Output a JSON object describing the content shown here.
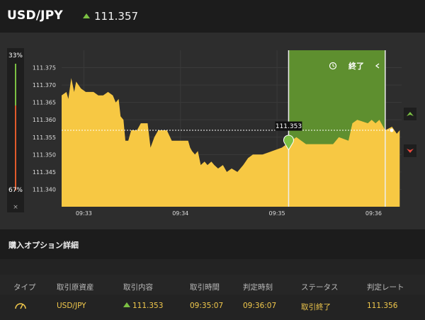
{
  "header": {
    "pair": "USD/JPY",
    "price": "111.357",
    "trend_icon": "up-arrow-icon"
  },
  "gauge": {
    "top_pct": "33%",
    "bottom_pct": "67%",
    "close": "×",
    "top_share": 0.33,
    "bottom_share": 0.67,
    "up_color": "#7bc043",
    "down_color": "#e05a2b"
  },
  "chart": {
    "end_label": "終了",
    "entry_price_label": "111.353",
    "colors": {
      "area": "#f7c843",
      "window": "#5e8f2f",
      "up": "#7bc043",
      "down": "#e8493e"
    }
  },
  "chart_data": {
    "type": "area",
    "ylim": [
      111.335,
      111.38
    ],
    "yticks": [
      "111.375",
      "111.370",
      "111.365",
      "111.360",
      "111.355",
      "111.350",
      "111.345",
      "111.340"
    ],
    "xticks": [
      "09:33",
      "09:34",
      "09:35",
      "09:36"
    ],
    "xlim_min": [
      32.77,
      36.29
    ],
    "entry": {
      "time": "09:35:07",
      "value": 111.353
    },
    "window": {
      "start_min": 35.12,
      "end_min": 36.12
    },
    "current_value": 111.357,
    "series": [
      {
        "points": [
          [
            32.77,
            111.367
          ],
          [
            32.82,
            111.368
          ],
          [
            32.84,
            111.366
          ],
          [
            32.87,
            111.372
          ],
          [
            32.9,
            111.368
          ],
          [
            32.92,
            111.371
          ],
          [
            32.97,
            111.369
          ],
          [
            33.02,
            111.368
          ],
          [
            33.1,
            111.368
          ],
          [
            33.15,
            111.367
          ],
          [
            33.2,
            111.367
          ],
          [
            33.25,
            111.368
          ],
          [
            33.3,
            111.367
          ],
          [
            33.33,
            111.365
          ],
          [
            33.36,
            111.366
          ],
          [
            33.38,
            111.361
          ],
          [
            33.41,
            111.36
          ],
          [
            33.43,
            111.354
          ],
          [
            33.46,
            111.354
          ],
          [
            33.49,
            111.357
          ],
          [
            33.55,
            111.357
          ],
          [
            33.59,
            111.359
          ],
          [
            33.66,
            111.359
          ],
          [
            33.69,
            111.352
          ],
          [
            33.73,
            111.355
          ],
          [
            33.77,
            111.357
          ],
          [
            33.86,
            111.357
          ],
          [
            33.91,
            111.354
          ],
          [
            34.0,
            111.354
          ],
          [
            34.08,
            111.354
          ],
          [
            34.1,
            111.352
          ],
          [
            34.12,
            111.351
          ],
          [
            34.15,
            111.35
          ],
          [
            34.18,
            111.351
          ],
          [
            34.21,
            111.347
          ],
          [
            34.25,
            111.348
          ],
          [
            34.28,
            111.347
          ],
          [
            34.32,
            111.348
          ],
          [
            34.35,
            111.347
          ],
          [
            34.39,
            111.346
          ],
          [
            34.44,
            111.347
          ],
          [
            34.48,
            111.345
          ],
          [
            34.53,
            111.346
          ],
          [
            34.59,
            111.345
          ],
          [
            34.65,
            111.347
          ],
          [
            34.7,
            111.349
          ],
          [
            34.75,
            111.35
          ],
          [
            34.85,
            111.35
          ],
          [
            34.95,
            111.351
          ],
          [
            35.05,
            111.352
          ],
          [
            35.1,
            111.353
          ],
          [
            35.15,
            111.354
          ],
          [
            35.2,
            111.355
          ],
          [
            35.3,
            111.353
          ],
          [
            35.45,
            111.353
          ],
          [
            35.58,
            111.353
          ],
          [
            35.64,
            111.355
          ],
          [
            35.74,
            111.354
          ],
          [
            35.78,
            111.359
          ],
          [
            35.83,
            111.36
          ],
          [
            35.94,
            111.359
          ],
          [
            35.98,
            111.36
          ],
          [
            36.02,
            111.359
          ],
          [
            36.06,
            111.36
          ],
          [
            36.12,
            111.357
          ],
          [
            36.19,
            111.358
          ],
          [
            36.24,
            111.356
          ],
          [
            36.27,
            111.357
          ]
        ]
      }
    ]
  },
  "details": {
    "title": "購入オプション詳細",
    "headers": [
      "タイプ",
      "取引原資産",
      "取引内容",
      "取引時間",
      "判定時刻",
      "ステータス",
      "判定レート"
    ],
    "row": {
      "type_icon": "gauge-icon",
      "asset": "USD/JPY",
      "content": "111.353",
      "trade_time": "09:35:07",
      "judge_time": "09:36:07",
      "status": "取引終了",
      "rate": "111.356"
    }
  }
}
